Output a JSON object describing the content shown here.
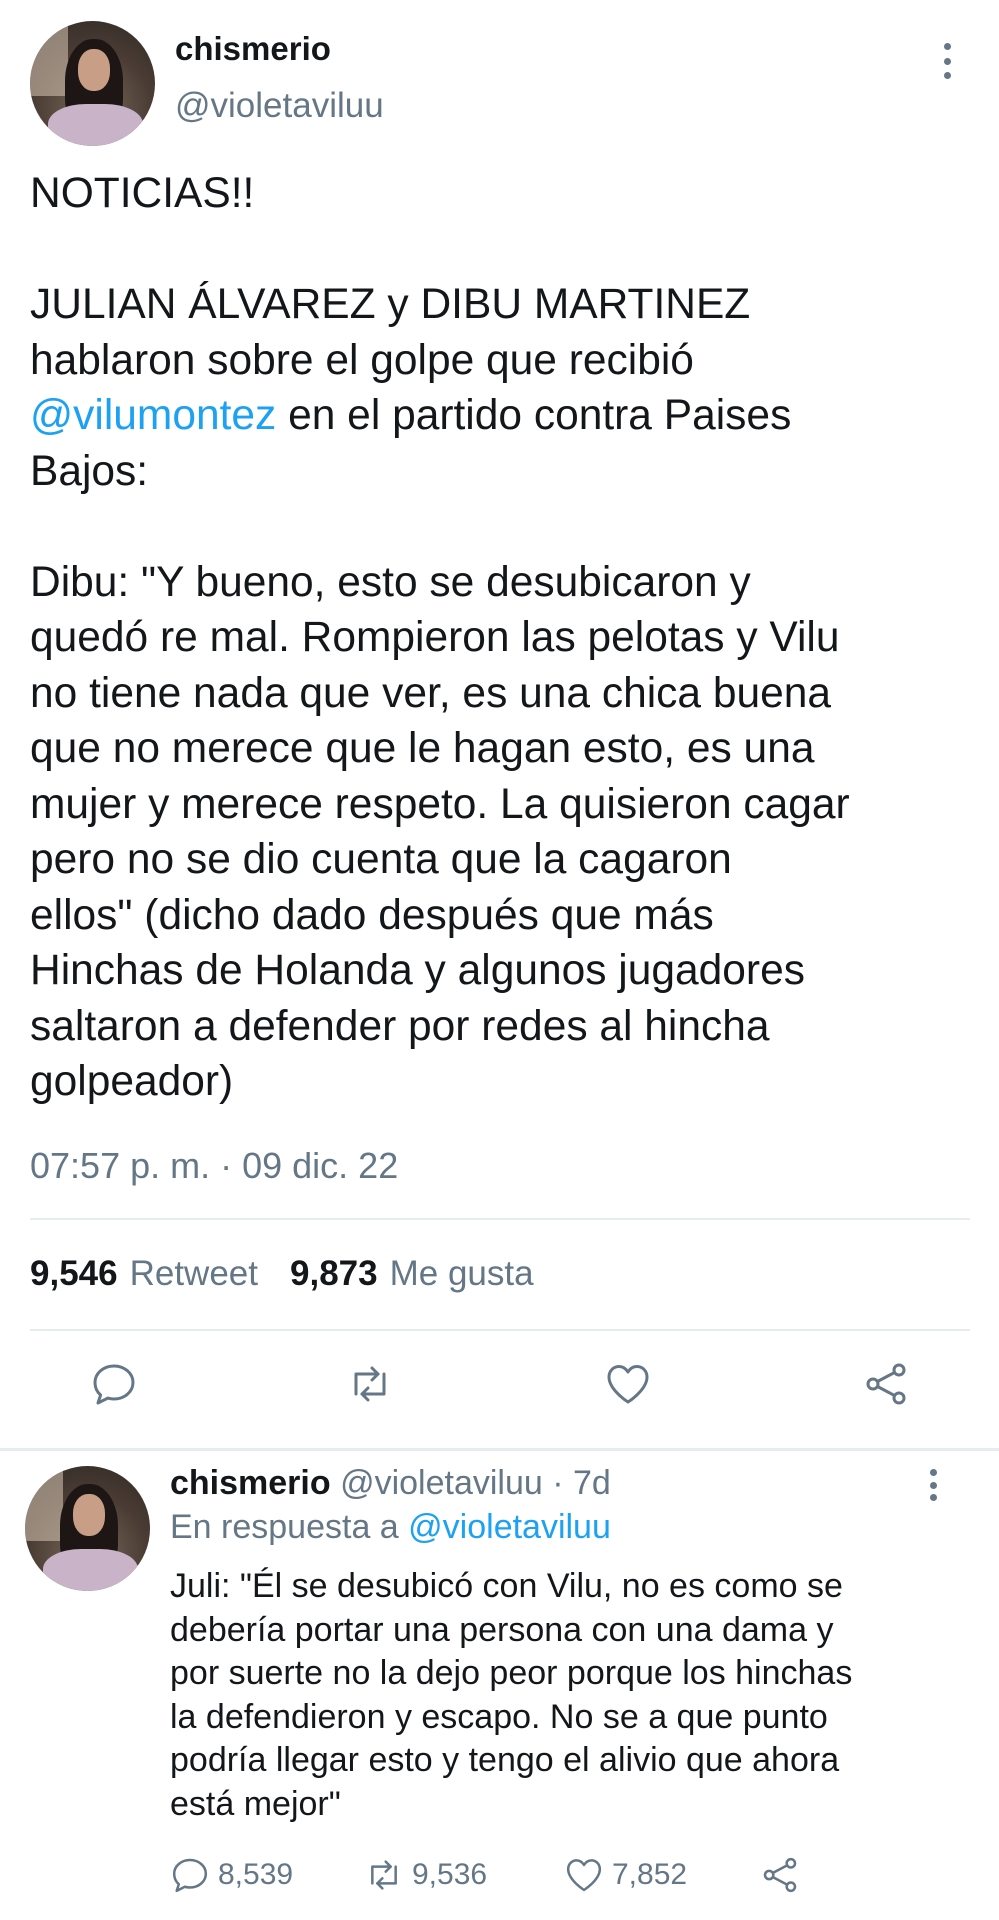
{
  "tweet": {
    "display_name": "chismerio",
    "handle": "@violetaviluu",
    "text_lines": [
      "NOTICIAS!!",
      "",
      "JULIAN ÁLVAREZ y DIBU MARTINEZ",
      "hablaron sobre el golpe que recibió",
      "",
      "Bajos:",
      "",
      "Dibu: \"Y bueno, esto se desubicaron y",
      "quedó re mal. Rompieron las pelotas y Vilu",
      "no tiene nada que ver, es una chica buena",
      "que no merece que le hagan esto, es una",
      "mujer y merece respeto. La quisieron cagar",
      "pero no se dio cuenta que la cagaron",
      "ellos\" (dicho dado después que más",
      "Hinchas de Holanda y algunos jugadores",
      "saltaron a defender por redes al hincha",
      "golpeador)"
    ],
    "mention": "@vilumontez",
    "mention_line_rest": " en el partido contra Paises",
    "timestamp": "07:57 p. m. · 09 dic. 22",
    "retweets_count": "9,546",
    "retweets_label": "Retweet",
    "likes_count": "9,873",
    "likes_label": "Me gusta",
    "actions": {
      "reply_icon": "reply-icon",
      "retweet_icon": "retweet-icon",
      "like_icon": "heart-icon",
      "share_icon": "share-icon"
    }
  },
  "reply": {
    "display_name": "chismerio",
    "meta": "@violetaviluu · 7d",
    "reply_to_prefix": "En respuesta a ",
    "reply_to_handle": "@violetaviluu",
    "text_lines": [
      "Juli: \"Él se desubicó con Vilu, no es como se",
      "debería portar una persona con una dama y",
      "por suerte no la dejo peor porque los hinchas",
      "la defendieron y escapo. No se a que punto",
      "podría llegar esto y tengo el alivio que ahora",
      "está mejor\""
    ],
    "replies_count": "8,539",
    "retweets_count": "9,536",
    "likes_count": "7,852"
  },
  "colors": {
    "text": "#14171a",
    "muted": "#657786",
    "link": "#1da1f2",
    "divider": "#e6ecf0"
  }
}
